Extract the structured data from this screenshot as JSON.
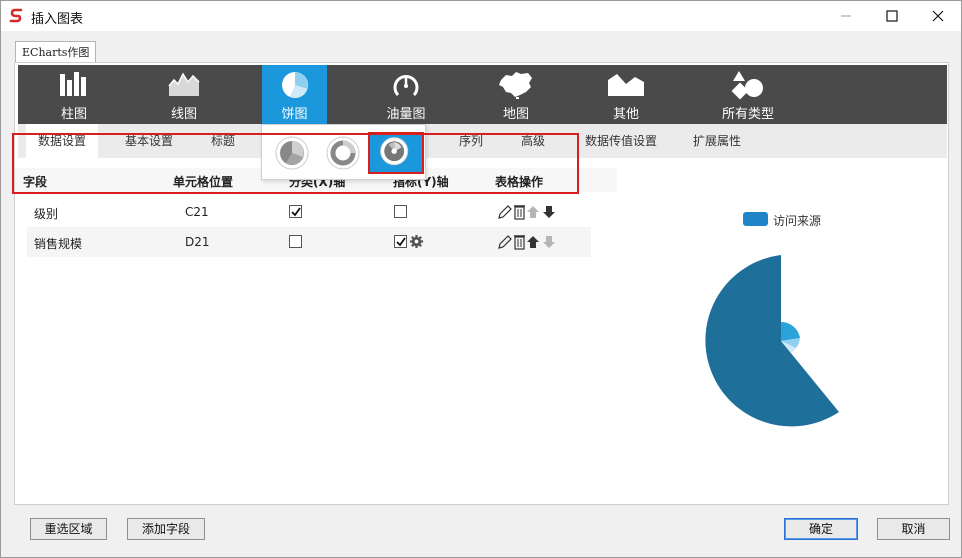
{
  "window": {
    "title": "插入图表"
  },
  "tab": {
    "label": "ECharts作图"
  },
  "chart_types": [
    {
      "label": "柱图"
    },
    {
      "label": "线图"
    },
    {
      "label": "饼图"
    },
    {
      "label": "油量图"
    },
    {
      "label": "地图"
    },
    {
      "label": "其他"
    },
    {
      "label": "所有类型"
    }
  ],
  "active_chart_type": "饼图",
  "subtabs": [
    {
      "label": "数据设置"
    },
    {
      "label": "基本设置"
    },
    {
      "label": "标题"
    },
    {
      "label": "序列"
    },
    {
      "label": "高级"
    },
    {
      "label": "数据传值设置"
    },
    {
      "label": "扩展属性"
    }
  ],
  "grid": {
    "headers": {
      "field": "字段",
      "cell": "单元格位置",
      "category": "分类(X)轴",
      "metric": "指标(Y)轴",
      "ops": "表格操作"
    },
    "rows": [
      {
        "field": "级别",
        "cell": "C21",
        "category_checked": true,
        "metric_checked": false
      },
      {
        "field": "销售规模",
        "cell": "D21",
        "category_checked": false,
        "metric_checked": true
      }
    ]
  },
  "preview": {
    "legend": "访问来源",
    "colors": {
      "primary": "#1f6f9b",
      "accent": "#2aa3db",
      "light": "#8fd0ee"
    }
  },
  "buttons": {
    "reselect": "重选区域",
    "add_field": "添加字段",
    "ok": "确定",
    "cancel": "取消"
  },
  "accent_color": "#1b97dc"
}
